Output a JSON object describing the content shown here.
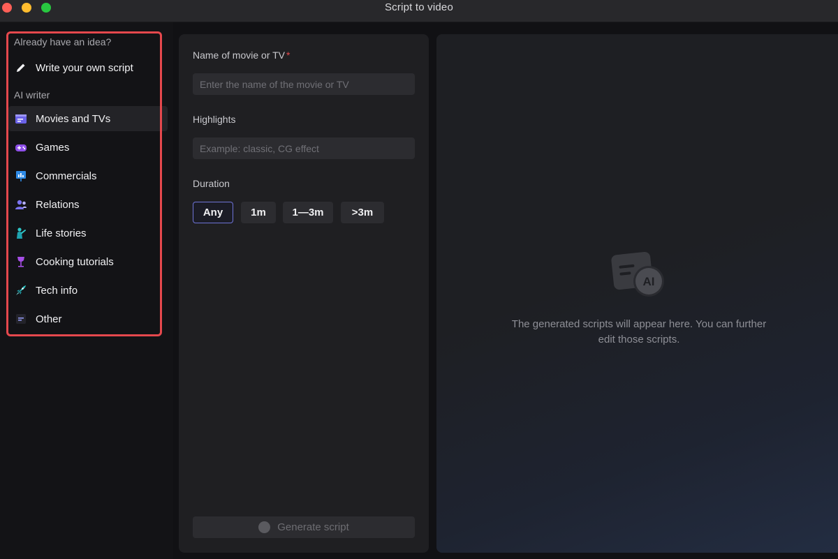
{
  "window": {
    "title": "Script to video"
  },
  "sidebar": {
    "idea_section": "Already have an idea?",
    "write_own": "Write your own script",
    "ai_section": "AI writer",
    "items": [
      {
        "label": "Movies and TVs",
        "icon": "movie-icon",
        "active": true
      },
      {
        "label": "Games",
        "icon": "gamepad-icon"
      },
      {
        "label": "Commercials",
        "icon": "chart-icon"
      },
      {
        "label": "Relations",
        "icon": "people-icon"
      },
      {
        "label": "Life stories",
        "icon": "person-icon"
      },
      {
        "label": "Cooking tutorials",
        "icon": "wine-glass-icon"
      },
      {
        "label": "Tech info",
        "icon": "rocket-icon"
      },
      {
        "label": "Other",
        "icon": "text-lines-icon"
      }
    ]
  },
  "form": {
    "name_label": "Name of movie or TV",
    "required_mark": "*",
    "name_placeholder": "Enter the name of the movie or TV",
    "highlights_label": "Highlights",
    "highlights_placeholder": "Example: classic, CG effect",
    "duration_label": "Duration",
    "duration_options": [
      "Any",
      "1m",
      "1—3m",
      ">3m"
    ],
    "duration_selected": "Any",
    "generate_label": "Generate script"
  },
  "result": {
    "empty_line1": "The generated scripts will appear here. You can further",
    "empty_line2": "edit those scripts.",
    "ai_badge": "AI"
  },
  "colors": {
    "accent": "#6f74d8",
    "highlight_border": "#e5484d"
  }
}
